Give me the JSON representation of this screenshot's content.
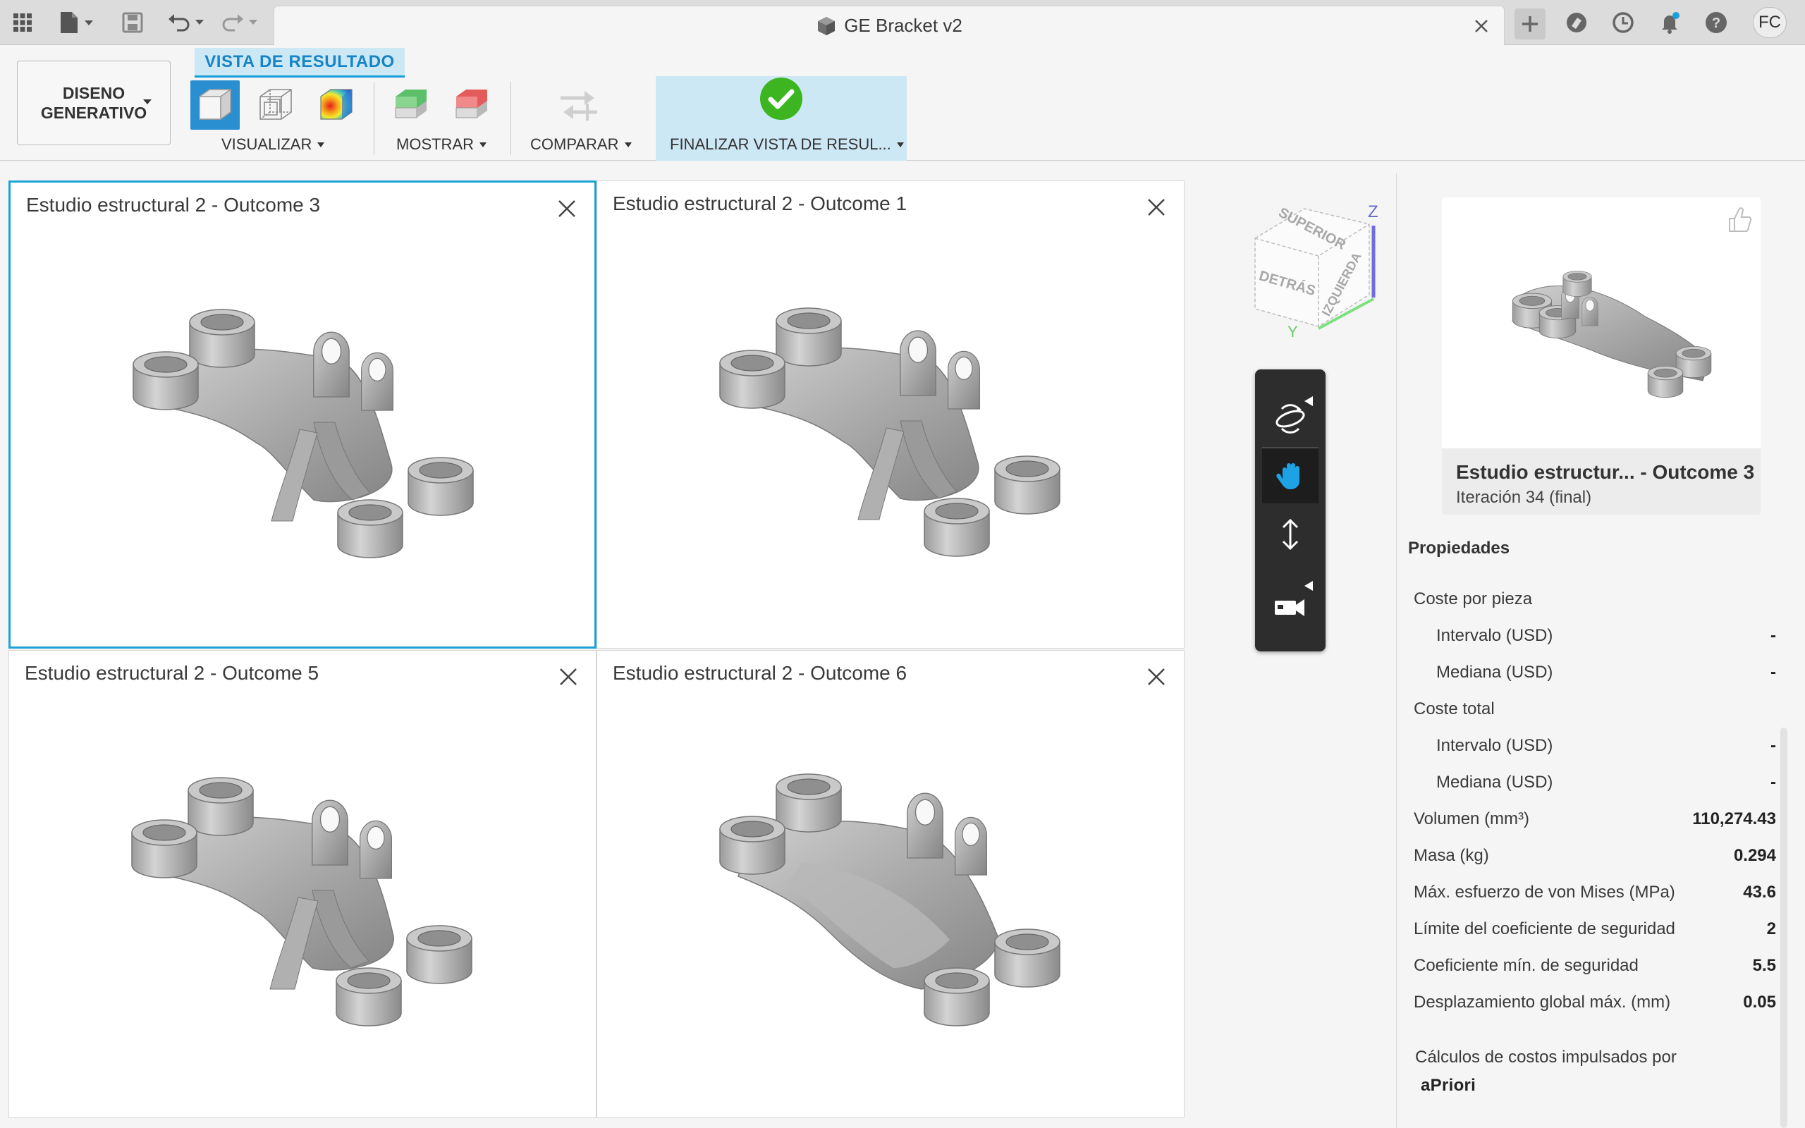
{
  "app": {
    "document_title": "GE Bracket v2",
    "user_initials": "FC"
  },
  "toolbar": {
    "workspace_label": "DISENO\nGENERATIVO",
    "active_tab": "VISTA DE RESULTADO",
    "groups": {
      "visualize": "VISUALIZAR",
      "show": "MOSTRAR",
      "compare": "COMPARAR",
      "finish": "FINALIZAR VISTA DE RESUL..."
    }
  },
  "viewports": [
    {
      "title": "Estudio estructural 2 - Outcome 3",
      "selected": true
    },
    {
      "title": "Estudio estructural 2 - Outcome 1",
      "selected": false
    },
    {
      "title": "Estudio estructural 2 - Outcome 5",
      "selected": false
    },
    {
      "title": "Estudio estructural 2 - Outcome 6",
      "selected": false
    }
  ],
  "viewcube": {
    "top": "SUPERIOR",
    "back": "DETRÁS",
    "left": "IZQUIERDA",
    "axis_z": "Z",
    "axis_y": "Y"
  },
  "details": {
    "card_title": "Estudio estructur... - Outcome 3",
    "card_subtitle": "Iteración 34 (final)",
    "properties_title": "Propiedades",
    "rows": [
      {
        "label": "Coste por pieza",
        "value": "",
        "indent": false
      },
      {
        "label": "Intervalo (USD)",
        "value": "-",
        "indent": true
      },
      {
        "label": "Mediana (USD)",
        "value": "-",
        "indent": true
      },
      {
        "label": "Coste total",
        "value": "",
        "indent": false
      },
      {
        "label": "Intervalo (USD)",
        "value": "-",
        "indent": true
      },
      {
        "label": "Mediana (USD)",
        "value": "-",
        "indent": true
      },
      {
        "label": "Volumen (mm³)",
        "value": "110,274.43",
        "indent": false
      },
      {
        "label": "Masa (kg)",
        "value": "0.294",
        "indent": false
      },
      {
        "label": "Máx. esfuerzo de von Mises (MPa)",
        "value": "43.6",
        "indent": false
      },
      {
        "label": "Límite del coeficiente de seguridad",
        "value": "2",
        "indent": false
      },
      {
        "label": "Coeficiente mín. de seguridad",
        "value": "5.5",
        "indent": false
      },
      {
        "label": "Desplazamiento global máx. (mm)",
        "value": "0.05",
        "indent": false
      }
    ],
    "credit": "Cálculos de costos impulsados por",
    "credit_logo": "aPriori"
  },
  "colors": {
    "accent": "#1ca3d6",
    "ribbon_tab_bg": "#cde8f5",
    "finish_check": "#3cb521"
  }
}
